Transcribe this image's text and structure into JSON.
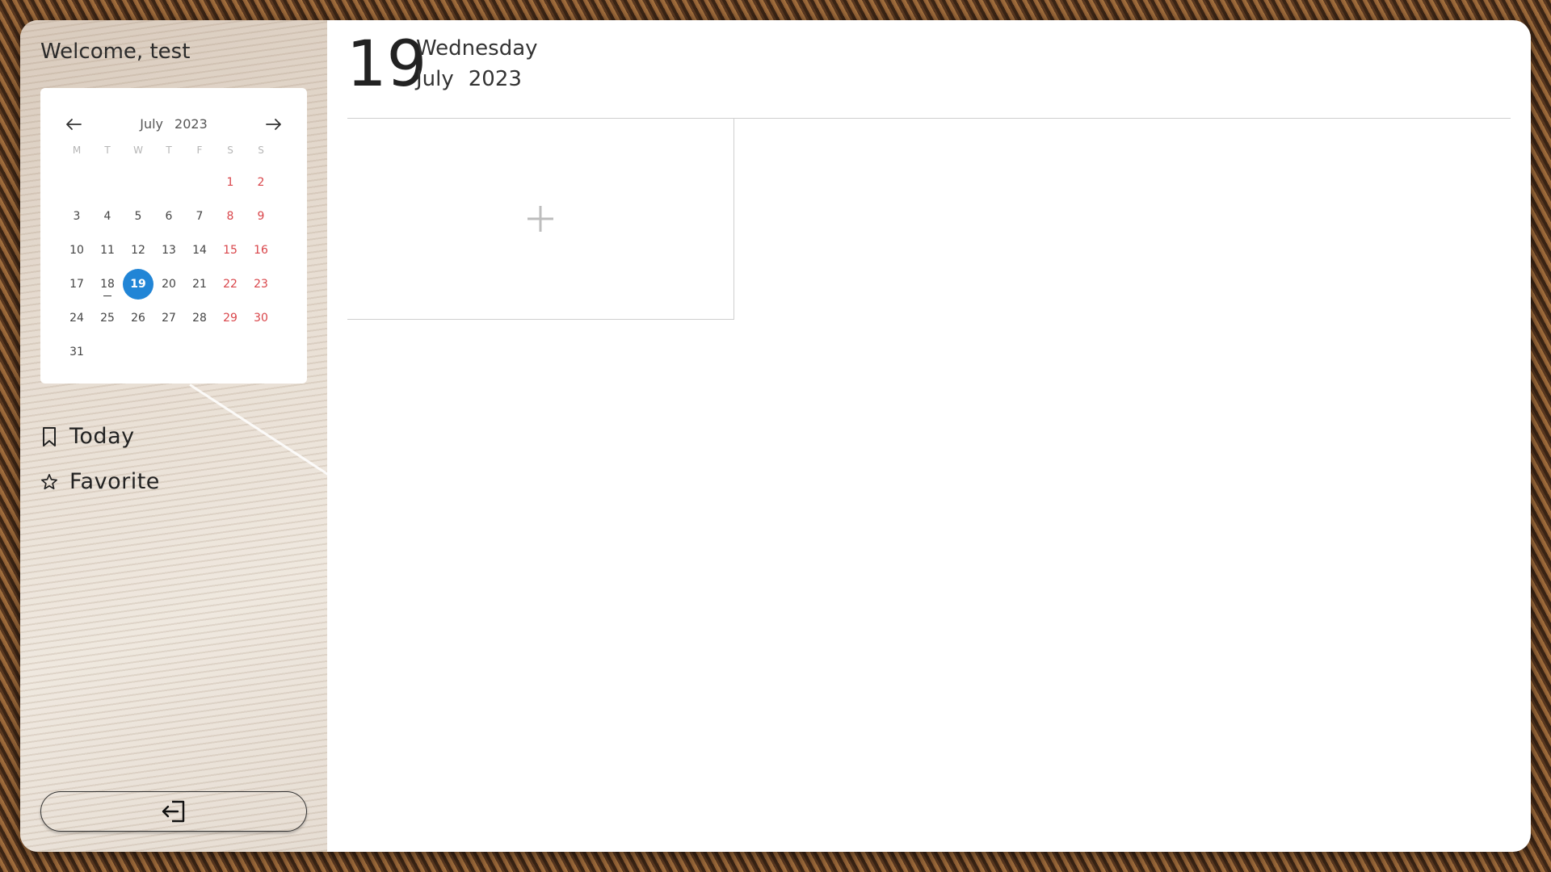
{
  "sidebar": {
    "welcome": "Welcome, test",
    "calendar": {
      "month": "July",
      "year": "2023",
      "weekdays": [
        "M",
        "T",
        "W",
        "T",
        "F",
        "S",
        "S"
      ],
      "weeks": [
        [
          "",
          "",
          "",
          "",
          "",
          "1",
          "2"
        ],
        [
          "3",
          "4",
          "5",
          "6",
          "7",
          "8",
          "9"
        ],
        [
          "10",
          "11",
          "12",
          "13",
          "14",
          "15",
          "16"
        ],
        [
          "17",
          "18",
          "19",
          "20",
          "21",
          "22",
          "23"
        ],
        [
          "24",
          "25",
          "26",
          "27",
          "28",
          "29",
          "30"
        ],
        [
          "31",
          "",
          "",
          "",
          "",
          "",
          ""
        ]
      ],
      "selected_day": "19",
      "today_day": "18",
      "weekend_color": "#d9454a",
      "selected_color": "#2185d6"
    },
    "nav": [
      {
        "label": "Today",
        "icon": "bookmark-icon"
      },
      {
        "label": "Favorite",
        "icon": "star-icon"
      }
    ],
    "logout_icon": "logout-icon"
  },
  "header": {
    "day_number": "19",
    "weekday": "Wednesday",
    "month": "July",
    "year": "2023"
  },
  "main": {
    "add_icon": "plus-icon"
  }
}
